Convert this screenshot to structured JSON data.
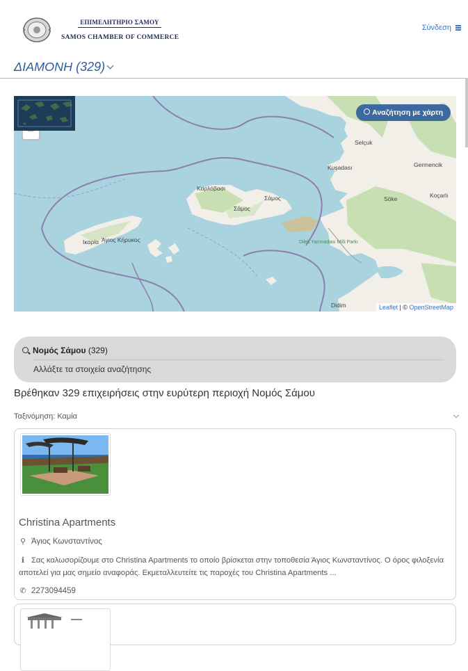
{
  "header": {
    "org_name_greek": "ΕΠΙΜΕΛΗΤΗΡΙΟ ΣΑΜΟΥ",
    "org_name_english": "SAMOS CHAMBER OF COMMERCE",
    "login_label": "Σύνδεση"
  },
  "page": {
    "section_title": "ΔΙΑΜΟΝΗ (329)"
  },
  "map": {
    "zoom_in": "+",
    "zoom_out": "−",
    "search_button": "Αναζήτηση με χάρτη",
    "attribution_leaflet": "Leaflet",
    "attribution_separator": " | © ",
    "attribution_osm": "OpenStreetMap",
    "labels": {
      "karlovasi": "Καρλόβασι",
      "samos_town": "Σάμος",
      "samos_island": "Σάμος",
      "agios_kirykos": "Άγιος Κήρυκος",
      "ikaria": "Ικαρία",
      "selcuk": "Selçuk",
      "kusadasi": "Kuşadası",
      "germencik": "Germencik",
      "soke": "Söke",
      "kocarli": "Koçarlı",
      "national_park": "Dilek Yarımadası Milli Parkı",
      "didim": "Didim"
    },
    "colors": {
      "sea": "#a9d3df",
      "land": "#f2efe9",
      "green": "#c8dfb3",
      "boundary": "#8c7fb0"
    }
  },
  "search_summary": {
    "location": "Νομός Σάμου",
    "count": "(329)",
    "change_label": "Αλλάξτε τα στοιχεία αναζήτησης"
  },
  "results": {
    "title": "Βρέθηκαν 329 επιχειρήσεις στην ευρύτερη περιοχή Νομός Σάμου",
    "sort_label": "Ταξινόμηση: Καμία"
  },
  "listings": [
    {
      "name": "Christina Apartments",
      "location": "Άγιος Κωνσταντίνος",
      "description": "Σας καλωσορίζουμε στο Christina Apartments το οποίο βρίσκεται στην τοποθεσία Άγιος Κωνσταντίνος. Ο όρος φιλοξενία αποτελεί για μας σημείο αναφοράς. Εκμεταλλευτείτε τις παροχές του Christina Apartments ...",
      "phone": "2273094459",
      "location_icon": "map-marker-icon",
      "info_icon": "info-icon",
      "phone_icon": "phone-icon"
    }
  ]
}
